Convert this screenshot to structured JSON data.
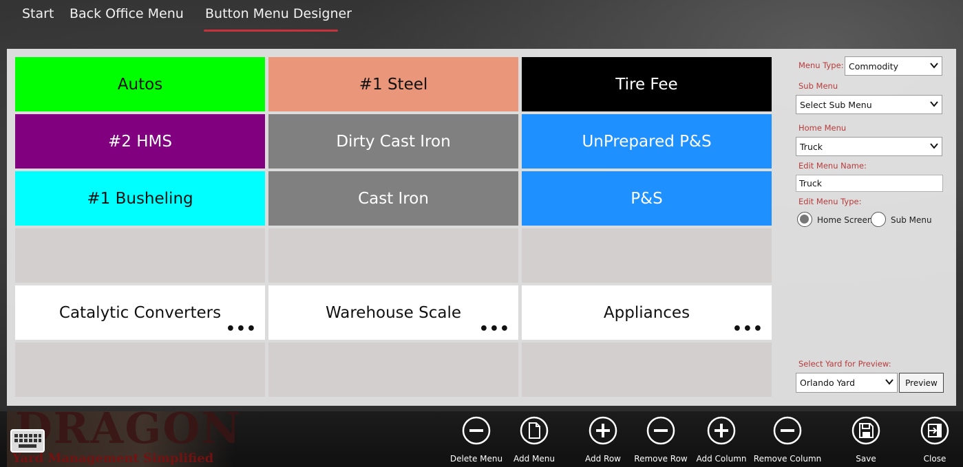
{
  "nav": {
    "items": [
      {
        "label": "Start"
      },
      {
        "label": "Back Office Menu"
      },
      {
        "label": "Button Menu Designer"
      }
    ],
    "active_index": 2,
    "accent_color": "#c8323c"
  },
  "grid": {
    "columns": 3,
    "rows": 6,
    "tiles": [
      {
        "label": "Autos",
        "bg": "#00ff00",
        "fg": "#111111",
        "has_more": false
      },
      {
        "label": "#1 Steel",
        "bg": "#e9967a",
        "fg": "#111111",
        "has_more": false
      },
      {
        "label": "Tire Fee",
        "bg": "#000000",
        "fg": "#ffffff",
        "has_more": false
      },
      {
        "label": "#2 HMS",
        "bg": "#800080",
        "fg": "#ffffff",
        "has_more": false
      },
      {
        "label": "Dirty Cast Iron",
        "bg": "#808080",
        "fg": "#ffffff",
        "has_more": false
      },
      {
        "label": "UnPrepared P&S",
        "bg": "#1e90ff",
        "fg": "#ffffff",
        "has_more": false
      },
      {
        "label": "#1 Busheling",
        "bg": "#00ffff",
        "fg": "#111111",
        "has_more": false
      },
      {
        "label": "Cast Iron",
        "bg": "#808080",
        "fg": "#ffffff",
        "has_more": false
      },
      {
        "label": "P&S",
        "bg": "#1e90ff",
        "fg": "#ffffff",
        "has_more": false
      },
      {
        "label": "",
        "bg": "#d3cfcf",
        "fg": "#111111",
        "has_more": false
      },
      {
        "label": "",
        "bg": "#d3cfcf",
        "fg": "#111111",
        "has_more": false
      },
      {
        "label": "",
        "bg": "#d3cfcf",
        "fg": "#111111",
        "has_more": false
      },
      {
        "label": "Catalytic Converters",
        "bg": "#ffffff",
        "fg": "#111111",
        "has_more": true
      },
      {
        "label": "Warehouse Scale",
        "bg": "#ffffff",
        "fg": "#111111",
        "has_more": true
      },
      {
        "label": "Appliances",
        "bg": "#ffffff",
        "fg": "#111111",
        "has_more": true
      },
      {
        "label": "",
        "bg": "#d3cfcf",
        "fg": "#111111",
        "has_more": false
      },
      {
        "label": "",
        "bg": "#d3cfcf",
        "fg": "#111111",
        "has_more": false
      },
      {
        "label": "",
        "bg": "#d3cfcf",
        "fg": "#111111",
        "has_more": false
      }
    ],
    "more_glyph": "•••"
  },
  "side": {
    "menu_type_label": "Menu Type:",
    "menu_type_value": "Commodity",
    "sub_menu_label": "Sub Menu",
    "sub_menu_value": "Select Sub Menu",
    "home_menu_label": "Home Menu",
    "home_menu_value": "Truck",
    "edit_name_label": "Edit Menu Name:",
    "edit_name_value": "Truck",
    "edit_type_label": "Edit Menu Type:",
    "radio_home": "Home Screen",
    "radio_sub": "Sub Menu",
    "selected_type": "Home Screen",
    "yard_label": "Select Yard for Preview:",
    "yard_value": "Orlando Yard",
    "preview_label": "Preview",
    "label_color": "#b83a3a"
  },
  "toolbar": {
    "logo_text": "DRAGON",
    "logo_sub": "Yard Management Simplified",
    "tools": [
      {
        "label": "Delete Menu",
        "icon": "minus-circle-icon"
      },
      {
        "label": "Add Menu",
        "icon": "document-circle-icon"
      },
      {
        "label": "Add Row",
        "icon": "plus-circle-icon"
      },
      {
        "label": "Remove Row",
        "icon": "minus-circle-icon"
      },
      {
        "label": "Add Column",
        "icon": "plus-circle-icon"
      },
      {
        "label": "Remove Column",
        "icon": "minus-circle-icon"
      },
      {
        "label": "Save",
        "icon": "save-circle-icon"
      },
      {
        "label": "Close",
        "icon": "close-circle-icon"
      }
    ],
    "keyboard_icon": "keyboard-icon"
  }
}
